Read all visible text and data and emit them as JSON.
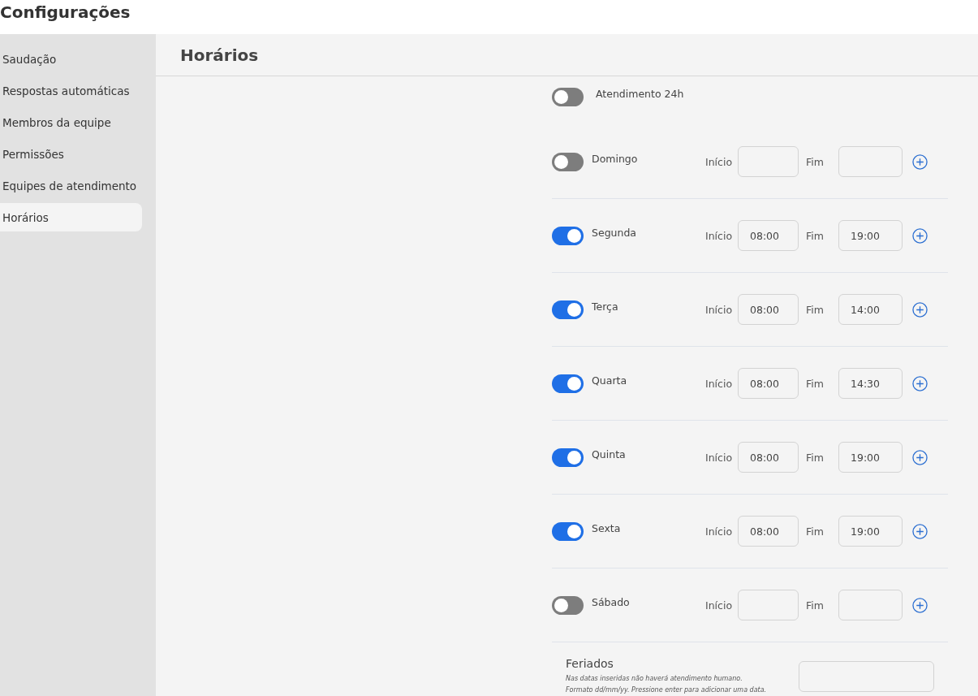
{
  "page_title": "Configurações",
  "sidebar": {
    "items": [
      {
        "label": "Saudação",
        "selected": false
      },
      {
        "label": "Respostas automáticas",
        "selected": false
      },
      {
        "label": "Membros da equipe",
        "selected": false
      },
      {
        "label": "Permissões",
        "selected": false
      },
      {
        "label": "Equipes de atendimento",
        "selected": false
      },
      {
        "label": "Horários",
        "selected": true
      }
    ]
  },
  "section_title": "Horários",
  "all_day": {
    "label": "Atendimento 24h",
    "on": false
  },
  "days": [
    {
      "name": "Domingo",
      "on": false,
      "start_label": "Início",
      "end_label": "Fim"
    },
    {
      "name": "Segunda",
      "on": true,
      "start_label": "Início",
      "start": "08:00",
      "end_label": "Fim",
      "end": "19:00"
    },
    {
      "name": "Terça",
      "on": true,
      "start_label": "Início",
      "start": "08:00",
      "end_label": "Fim",
      "end": "14:00"
    },
    {
      "name": "Quarta",
      "on": true,
      "start_label": "Início",
      "start": "08:00",
      "end_label": "Fim",
      "end": "14:30"
    },
    {
      "name": "Quinta",
      "on": true,
      "start_label": "Início",
      "start": "08:00",
      "end_label": "Fim",
      "end": "19:00"
    },
    {
      "name": "Sexta",
      "on": true,
      "start_label": "Início",
      "start": "08:00",
      "end_label": "Fim",
      "end": "19:00"
    },
    {
      "name": "Sábado",
      "on": false,
      "start_label": "Início",
      "end_label": "Fim"
    }
  ],
  "holidays": {
    "title": "Feriados",
    "description_lines": [
      "Nas datas inseridas não haverá atendimento humano.",
      "Formato dd/mm/yy. Pressione enter para adicionar uma data."
    ]
  }
}
